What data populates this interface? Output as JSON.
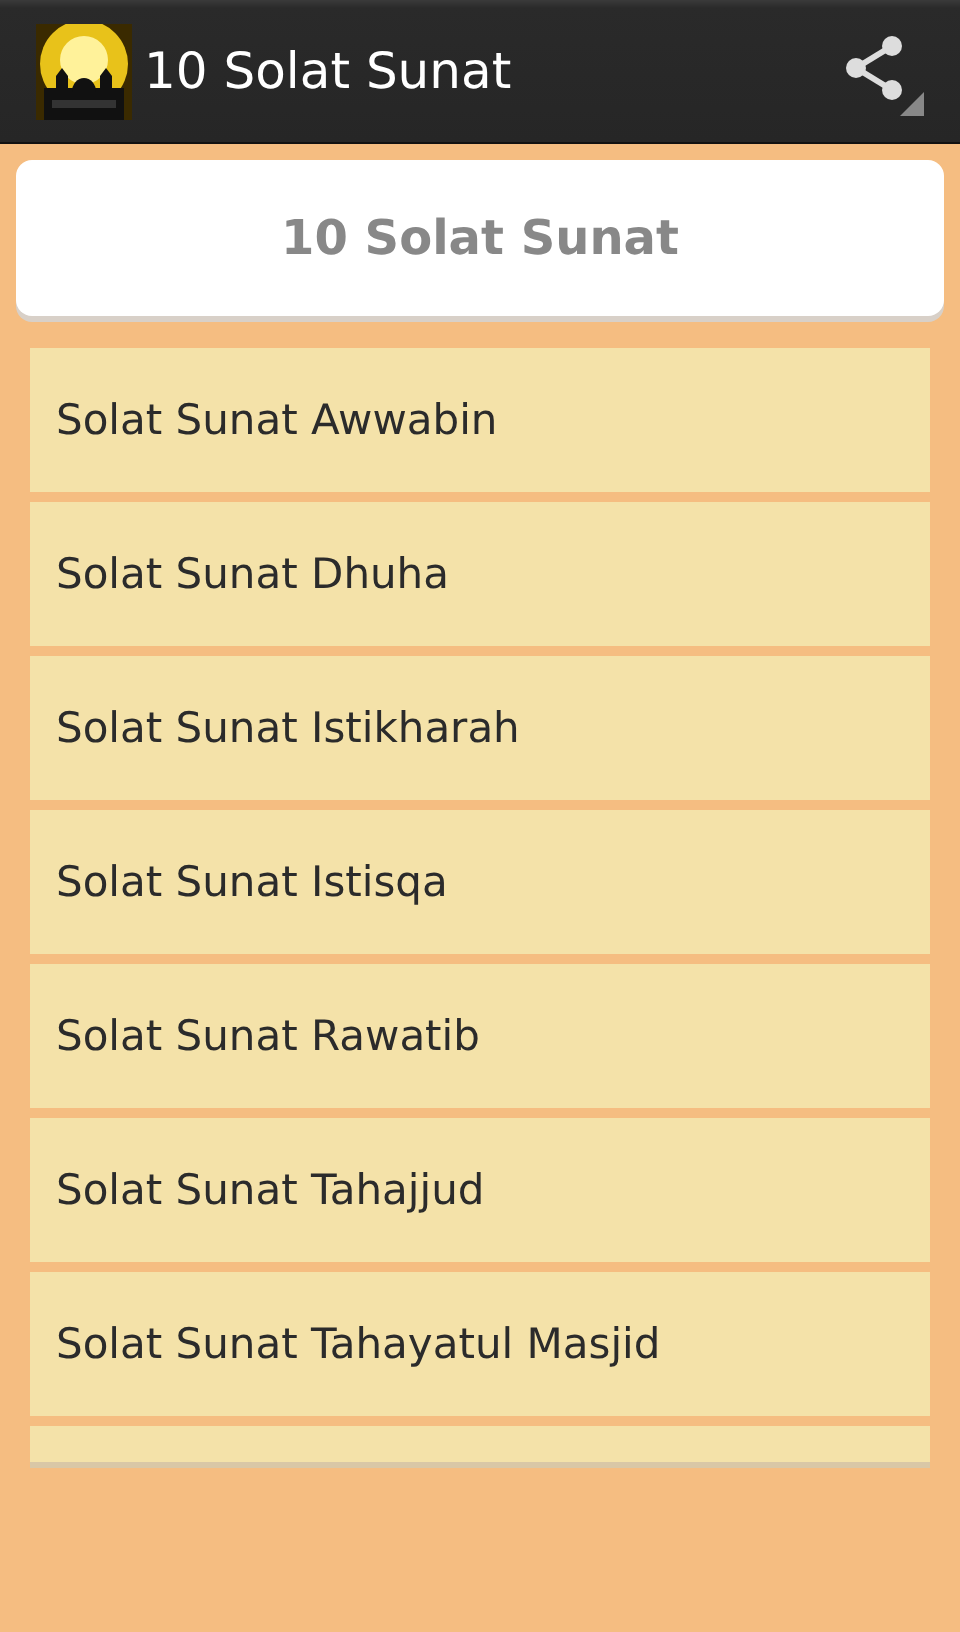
{
  "action_bar": {
    "title": "10 Solat Sunat"
  },
  "header": {
    "title": "10 Solat Sunat"
  },
  "items": [
    {
      "label": "Solat Sunat Awwabin"
    },
    {
      "label": "Solat Sunat Dhuha"
    },
    {
      "label": "Solat Sunat Istikharah"
    },
    {
      "label": "Solat Sunat Istisqa"
    },
    {
      "label": "Solat Sunat Rawatib"
    },
    {
      "label": "Solat Sunat Tahajjud"
    },
    {
      "label": "Solat Sunat Tahayatul Masjid"
    }
  ]
}
